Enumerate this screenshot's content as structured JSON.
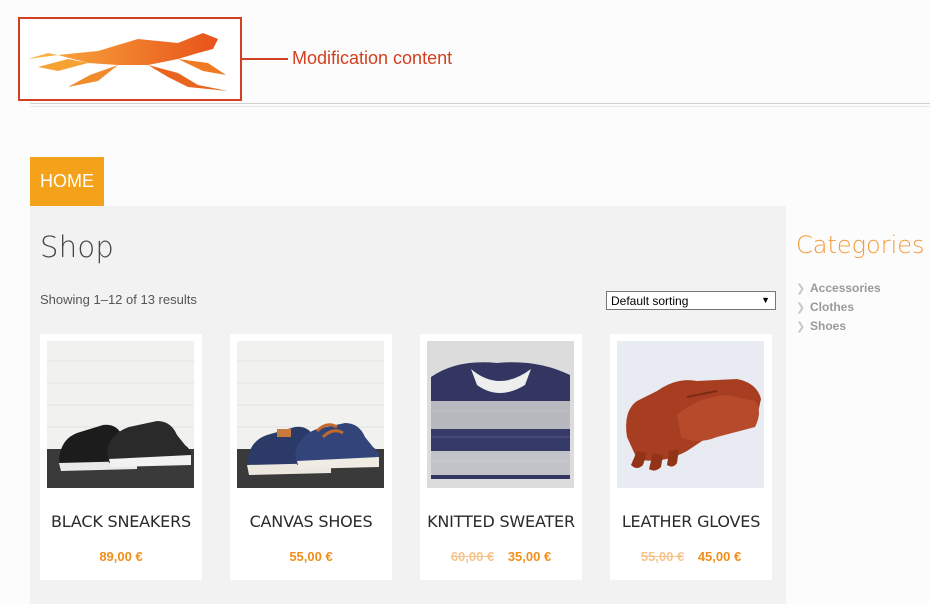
{
  "annotation": {
    "callout_text": "Modification content",
    "highlight_color": "#d2401f"
  },
  "header": {
    "logo_icon": "cheetah-logo-icon",
    "accent": "#f4a21a"
  },
  "nav": {
    "home_label": "HOME"
  },
  "shop": {
    "title": "Shop",
    "result_count": "Showing 1–12 of 13 results",
    "sorting": "Default sorting"
  },
  "products": [
    {
      "name": "BLACK SNEAKERS",
      "old_price": "",
      "price": "89,00 €",
      "image": "black-sneakers-image"
    },
    {
      "name": "CANVAS SHOES",
      "old_price": "",
      "price": "55,00 €",
      "image": "canvas-shoes-image"
    },
    {
      "name": "KNITTED SWEATER",
      "old_price": "60,00 €",
      "price": "35,00 €",
      "image": "knitted-sweater-image"
    },
    {
      "name": "LEATHER GLOVES",
      "old_price": "55,00 €",
      "price": "45,00 €",
      "image": "leather-gloves-image"
    }
  ],
  "sidebar": {
    "title": "Categories",
    "categories": [
      "Accessories",
      "Clothes",
      "Shoes"
    ]
  }
}
